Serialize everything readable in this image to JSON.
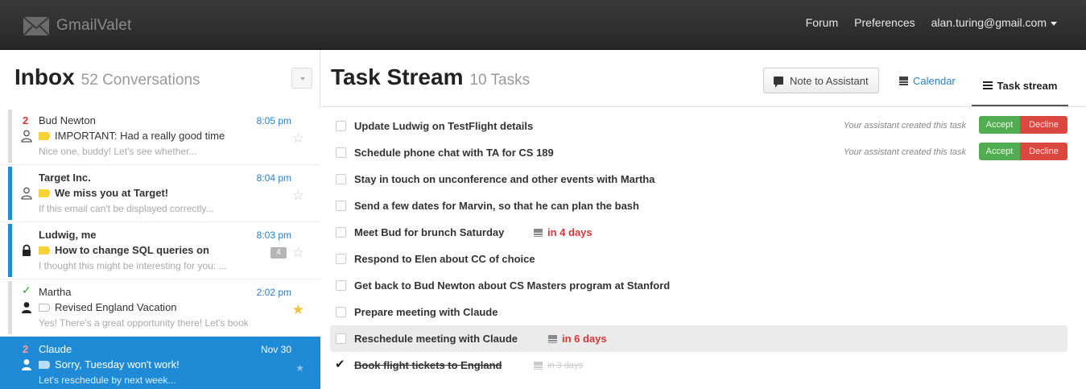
{
  "topbar": {
    "brand": "GmailValet",
    "nav": {
      "forum": "Forum",
      "preferences": "Preferences",
      "account": "alan.turing@gmail.com"
    }
  },
  "inbox": {
    "title": "Inbox",
    "count_label": "52 Conversations",
    "conversations": [
      {
        "count": "2",
        "sender": "Bud Newton",
        "time": "8:05 pm",
        "subject": "IMPORTANT: Had a really good time",
        "snippet": "Nice one, buddy! Let's see whether..."
      },
      {
        "sender": "Target Inc.",
        "time": "8:04 pm",
        "subject": "We miss you at Target!",
        "snippet": "If this email can't be displayed correctly..."
      },
      {
        "sender": "Ludwig, me",
        "time": "8:03 pm",
        "subject": "How to change SQL queries on",
        "snippet": "I thought this might be interesting for you: ...",
        "badge": "4"
      },
      {
        "sender": "Martha",
        "time": "2:02 pm",
        "subject": "Revised England Vacation",
        "snippet": "Yes! There's a great opportunity there! Let's book our"
      },
      {
        "count": "2",
        "sender": "Claude",
        "time": "Nov 30",
        "subject": "Sorry, Tuesday won't work!",
        "snippet": "Let's reschedule by next week..."
      }
    ]
  },
  "tasks": {
    "title": "Task Stream",
    "count_label": "10 Tasks",
    "note_button": "Note to Assistant",
    "calendar_link": "Calendar",
    "stream_tab": "Task stream",
    "assistant_note": "Your assistant created this task",
    "accept": "Accept",
    "decline": "Decline",
    "items": [
      {
        "label": "Update Ludwig on TestFlight details"
      },
      {
        "label": "Schedule phone chat with TA for CS 189"
      },
      {
        "label": "Stay in touch on unconference and other events with Martha"
      },
      {
        "label": "Send a few dates for Marvin, so that he can plan the bash"
      },
      {
        "label": "Meet Bud for brunch Saturday",
        "due": "in 4 days"
      },
      {
        "label": "Respond to Elen about CC of choice"
      },
      {
        "label": "Get back to Bud Newton about CS Masters program at Stanford"
      },
      {
        "label": "Prepare meeting with Claude"
      },
      {
        "label": "Reschedule meeting with Claude",
        "due": "in 6 days"
      },
      {
        "label": "Book flight tickets to England",
        "due": "in 3 days"
      }
    ]
  },
  "colors": {
    "accent_blue": "#1f8bd6",
    "accept_green": "#52ad52",
    "decline_red": "#da4840",
    "due_red": "#d63636",
    "star_yellow": "#f3c13a"
  },
  "icons": [
    "envelope-logo-icon",
    "caret-down-icon",
    "person-icon",
    "lock-icon",
    "tag-icon",
    "star-icon",
    "check-icon",
    "speech-bubble-icon",
    "calendar-icon",
    "list-icon",
    "checkbox-icon"
  ]
}
